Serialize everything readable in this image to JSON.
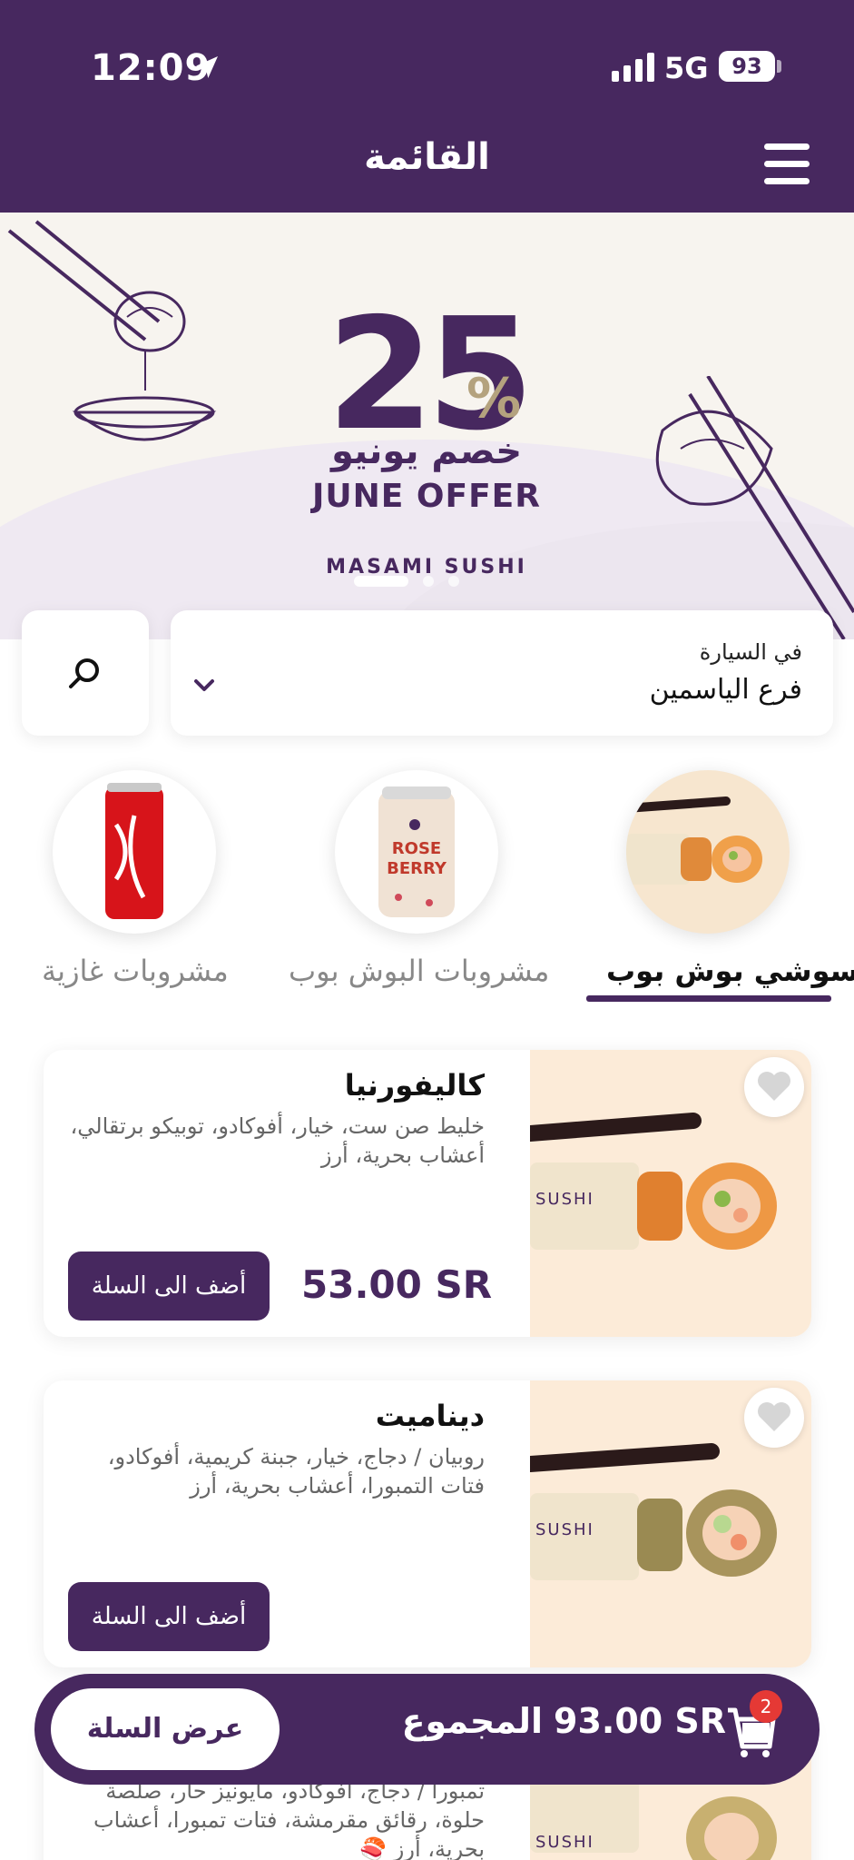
{
  "status_bar": {
    "time": "12:09",
    "network": "5G",
    "battery": "93"
  },
  "header": {
    "title": "القائمة"
  },
  "banner": {
    "number": "25",
    "percent": "%",
    "arabic_text": "خصم يونيو",
    "english_text": "JUNE OFFER",
    "brand": "MASAMI SUSHI"
  },
  "branch": {
    "label": "في السيارة",
    "name": "فرع  الياسمين"
  },
  "categories": [
    {
      "label": "سوشي بوش بوب",
      "active": true
    },
    {
      "label": "مشروبات البوش بوب",
      "active": false
    },
    {
      "label": "مشروبات غازية",
      "active": false
    }
  ],
  "products": [
    {
      "title": "كاليفورنيا",
      "description": "خليط صن ست، خيار، أفوكادو، توبيكو برتقالي، أعشاب بحرية، أرز",
      "price": "53.00 SR",
      "button": "أضف الى السلة"
    },
    {
      "title": "ديناميت",
      "description": "روبيان / دجاج، خيار، جبنة كريمية، أفوكادو، فتات التمبورا، أعشاب بحرية، أرز",
      "price": "",
      "button": "أضف الى السلة"
    },
    {
      "description": "تمبورا / دجاج، أفوكادو، مايونيز حار، صلصة حلوة، رقائق مقرمشة، فتات تمبورا، أعشاب بحرية، أرز 🍣"
    }
  ],
  "cart": {
    "view_label": "عرض السلة",
    "total_label": "المجموع",
    "total_amount": "93.00 SR",
    "count": "2"
  },
  "colors": {
    "brand": "#47285f",
    "card_image_bg": "#fcebd8",
    "badge": "#e53935"
  }
}
